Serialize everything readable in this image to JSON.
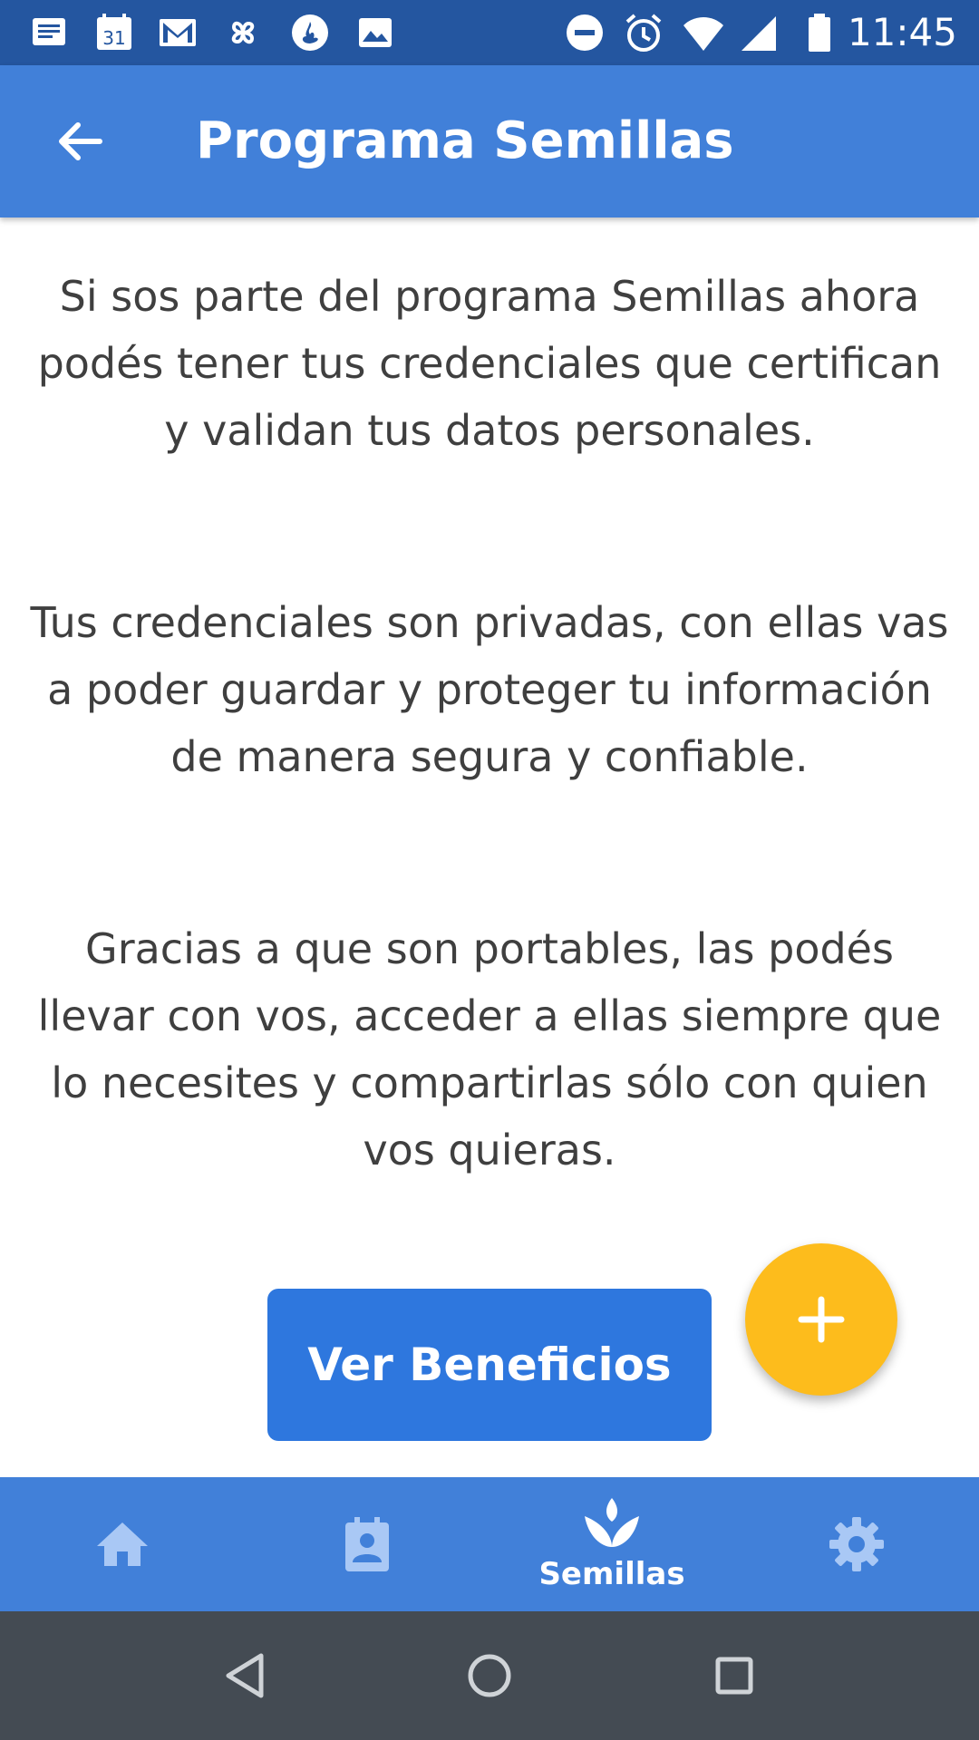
{
  "status_bar": {
    "time": "11:45",
    "left_icons": [
      "message-icon",
      "calendar-icon",
      "gmail-icon",
      "pinwheel-icon",
      "santander-icon",
      "image-icon"
    ],
    "calendar_day": "31",
    "right_icons": [
      "do-not-disturb-icon",
      "alarm-icon",
      "wifi-icon",
      "signal-icon",
      "battery-icon"
    ]
  },
  "app_bar": {
    "title": "Programa Semillas",
    "back_icon": "arrow-back-icon"
  },
  "content": {
    "paragraphs": [
      "Si sos parte del programa Semillas ahora podés tener tus credenciales que certifican y validan tus datos personales.",
      "Tus credenciales son privadas, con ellas vas a poder guardar y proteger tu información de manera segura y confiable.",
      "Gracias a que son portables, las podés llevar con vos, acceder a ellas siempre que lo necesites y compartirlas sólo con quien vos quieras."
    ],
    "cta_label": "Ver Beneficios",
    "fab_icon": "plus-icon"
  },
  "bottom_nav": {
    "items": [
      {
        "icon": "home-icon",
        "label": ""
      },
      {
        "icon": "contact-card-icon",
        "label": ""
      },
      {
        "icon": "sprout-icon",
        "label": "Semillas",
        "active": true
      },
      {
        "icon": "gear-icon",
        "label": ""
      }
    ]
  },
  "system_nav": {
    "icons": [
      "nav-back-triangle-icon",
      "nav-home-circle-icon",
      "nav-recents-square-icon"
    ]
  },
  "colors": {
    "status_bar": "#2456a0",
    "app_bar": "#4180d9",
    "cta_button": "#2e77de",
    "fab": "#fdbc1c",
    "text": "#3f3f3f",
    "system_nav": "#444b53",
    "inactive_nav_icon": "#a9c8f5"
  }
}
